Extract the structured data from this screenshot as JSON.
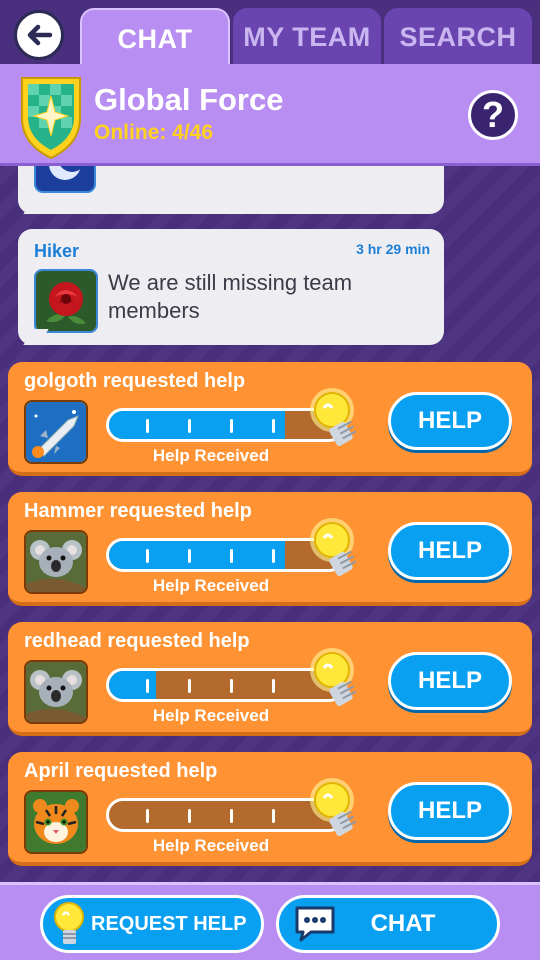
{
  "tabs": [
    {
      "label": "CHAT",
      "active": true
    },
    {
      "label": "MY TEAM",
      "active": false
    },
    {
      "label": "SEARCH",
      "active": false
    }
  ],
  "team": {
    "name": "Global Force",
    "online": "Online: 4/46"
  },
  "messages": [
    {
      "author": "Hiker",
      "time": "3 hr 29 min",
      "text": "We are still missing team members",
      "avatar_icon": "rose-icon"
    }
  ],
  "help_requests": [
    {
      "title": "golgoth requested help",
      "label": "Help Received",
      "progress": 0.75,
      "avatar_icon": "space-shuttle-icon",
      "button": "HELP"
    },
    {
      "title": "Hammer requested help",
      "label": "Help Received",
      "progress": 0.75,
      "avatar_icon": "koala-icon",
      "button": "HELP"
    },
    {
      "title": "redhead requested help",
      "label": "Help Received",
      "progress": 0.2,
      "avatar_icon": "koala-icon",
      "button": "HELP"
    },
    {
      "title": "April requested help",
      "label": "Help Received",
      "progress": 0.0,
      "avatar_icon": "tiger-icon",
      "button": "HELP"
    }
  ],
  "bottom": {
    "request_help": "REQUEST HELP",
    "chat": "CHAT"
  },
  "colors": {
    "background": "#4b2f7f",
    "header": "#b88ef2",
    "card": "#ff9233",
    "accent_blue": "#0aa0f2",
    "online_yellow": "#ffd21f"
  }
}
